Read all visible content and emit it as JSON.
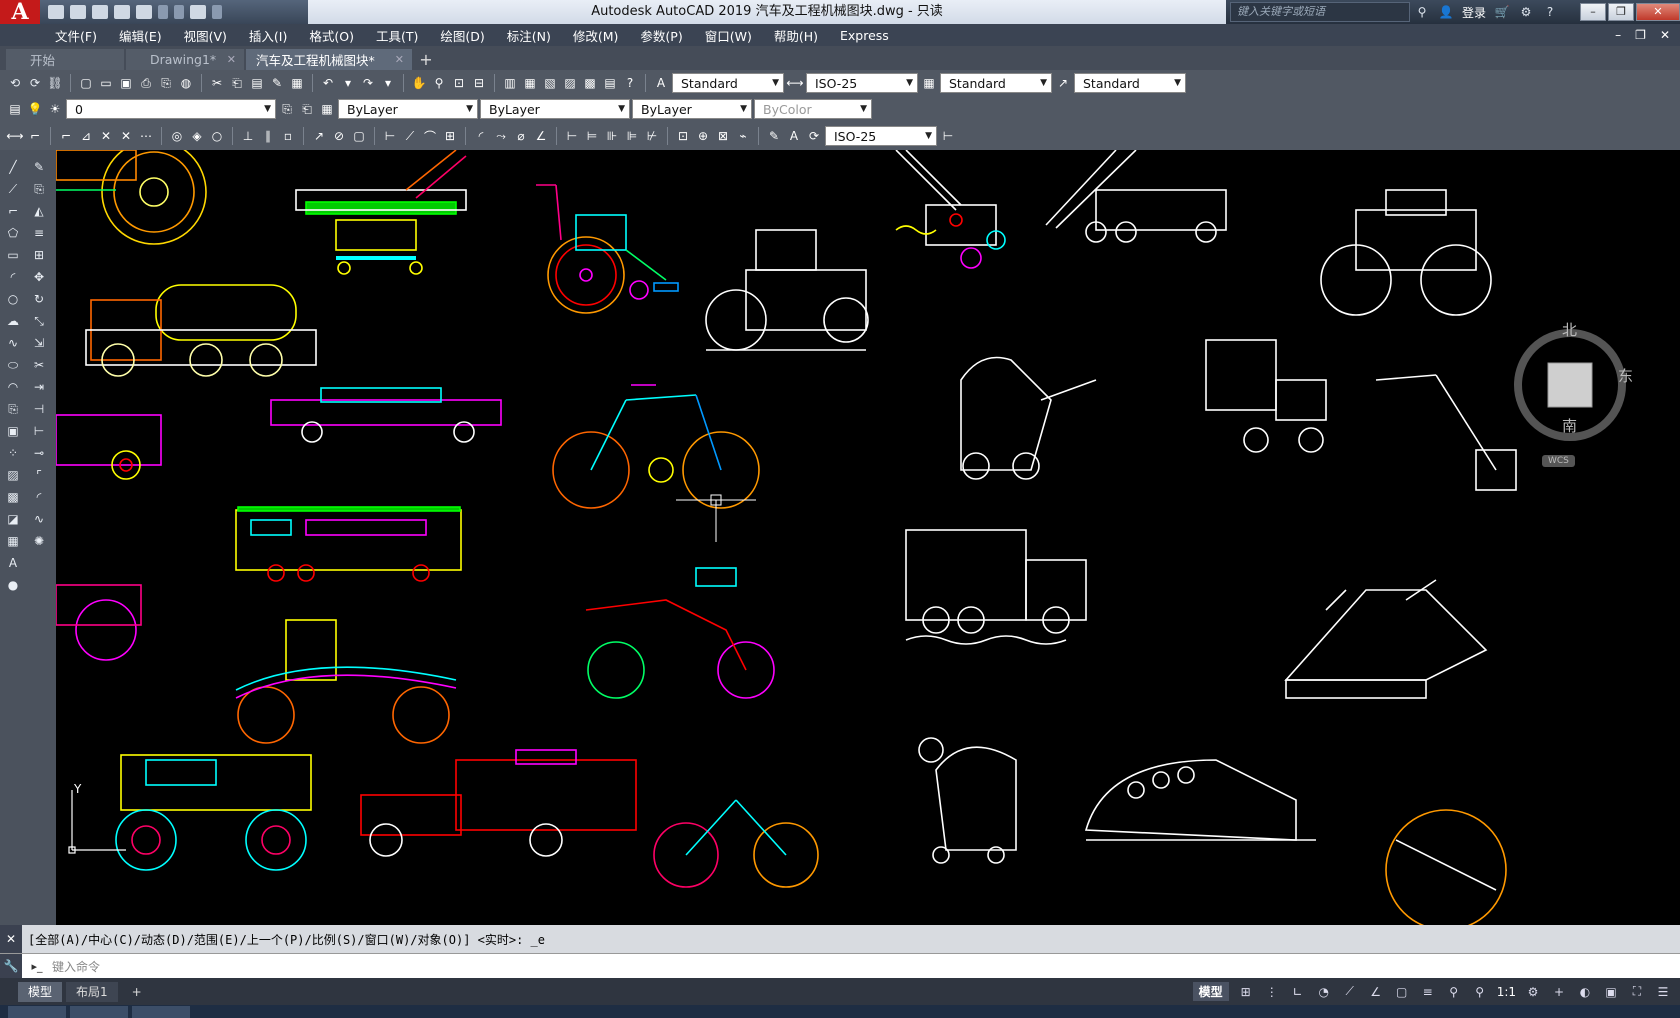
{
  "app": {
    "logo": "A",
    "title": "Autodesk AutoCAD 2019    汽车及工程机械图块.dwg - 只读",
    "search_placeholder": "键入关键字或短语",
    "login": "登录"
  },
  "menu": [
    "文件(F)",
    "编辑(E)",
    "视图(V)",
    "插入(I)",
    "格式(O)",
    "工具(T)",
    "绘图(D)",
    "标注(N)",
    "修改(M)",
    "参数(P)",
    "窗口(W)",
    "帮助(H)",
    "Express"
  ],
  "tabs": [
    {
      "label": "开始"
    },
    {
      "label": "Drawing1*"
    },
    {
      "label": "汽车及工程机械图块*"
    }
  ],
  "toolbar1": {
    "text_style": "Standard",
    "dim_style": "ISO-25",
    "table_style": "Standard",
    "mleader_style": "Standard"
  },
  "toolbar2": {
    "layer": "0",
    "color": "ByLayer",
    "linetype": "ByLayer",
    "lineweight": "ByLayer",
    "plotstyle": "ByColor"
  },
  "toolbar3": {
    "dim_style": "ISO-25"
  },
  "viewcube": {
    "north": "北",
    "east": "东",
    "south": "南",
    "wcs": "WCS"
  },
  "ucs": {
    "y": "Y"
  },
  "command": {
    "history": "[全部(A)/中心(C)/动态(D)/范围(E)/上一个(P)/比例(S)/窗口(W)/对象(O)] <实时>: _e",
    "placeholder": "键入命令"
  },
  "layout_tabs": [
    "模型",
    "布局1"
  ],
  "status": {
    "model": "模型",
    "scale": "1:1"
  },
  "colors": {
    "background": "#000000",
    "accent": "#c41a1a"
  }
}
